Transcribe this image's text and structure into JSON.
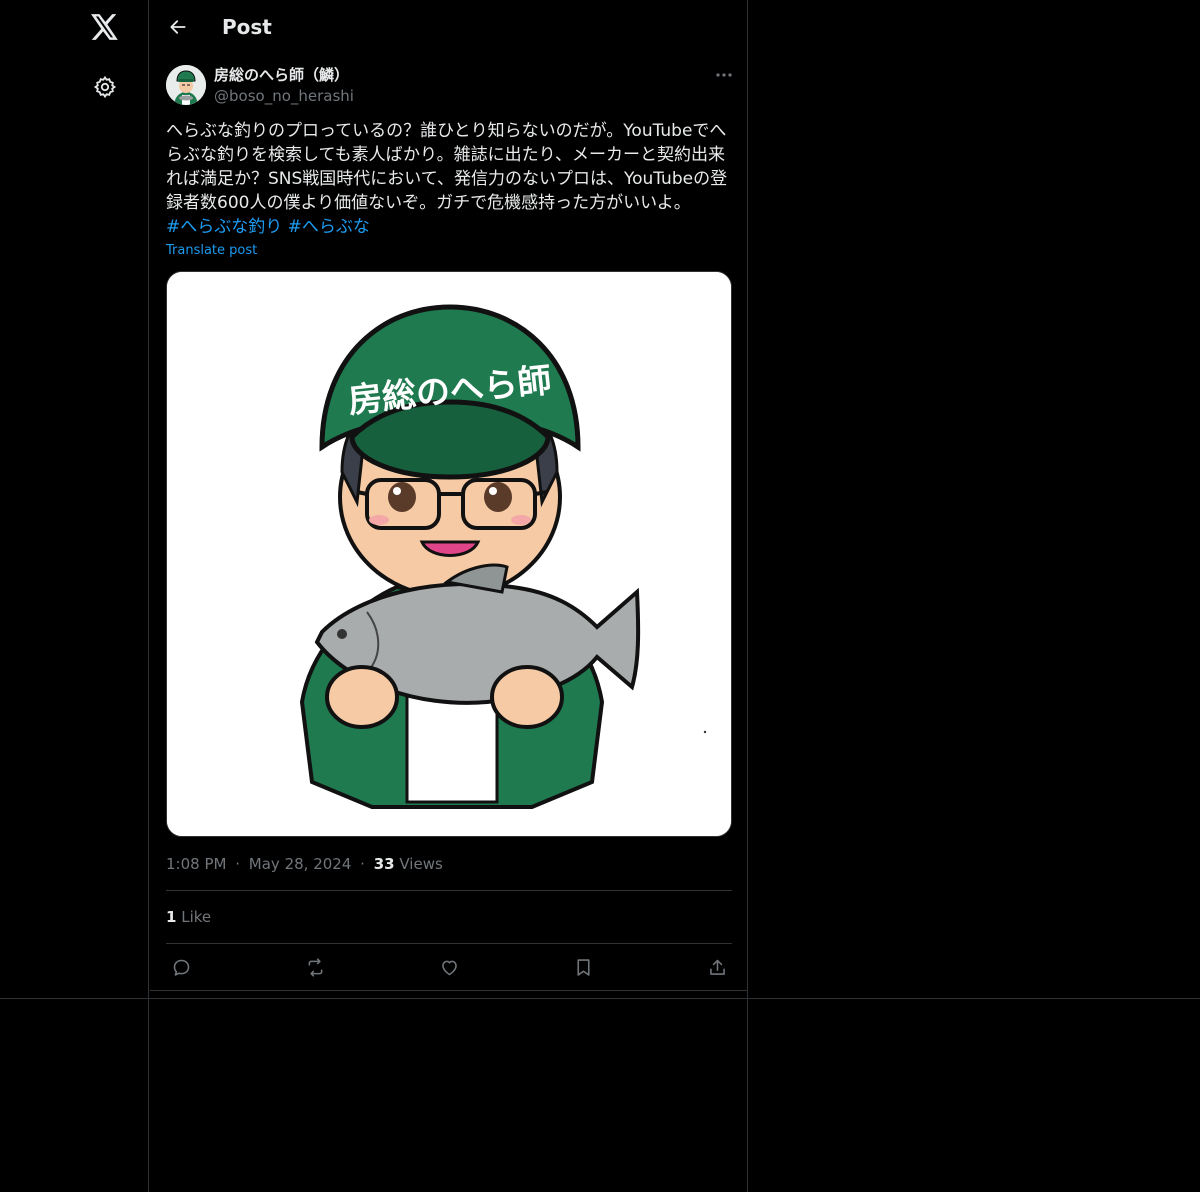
{
  "header": {
    "title": "Post",
    "back_icon": "arrow-left-icon"
  },
  "nav": {
    "logo_icon": "x-logo-icon",
    "settings_icon": "gear-icon"
  },
  "post": {
    "author": {
      "display_name": "房総のへら師（鱗）",
      "handle": "@boso_no_herashi"
    },
    "text": "へらぶな釣りのプロっているの？誰ひとり知らないのだが。YouTubeでへらぶな釣りを検索しても素人ばかり。雑誌に出たり、メーカーと契約出来れば満足か？SNS戦国時代において、発信力のないプロは、YouTubeの登録者数600人の僕より価値ないぞ。ガチで危機感持った方がいいよ。",
    "hashtags": [
      "#へらぶな釣り",
      "#へらぶな"
    ],
    "translate_label": "Translate post",
    "media": {
      "cap_text": "房総のへら師"
    },
    "time": "1:08 PM",
    "date": "May 28, 2024",
    "views_count": "33",
    "views_label": "Views",
    "likes_count": "1",
    "likes_label": "Like",
    "separator": "·"
  },
  "actions": [
    "reply-icon",
    "repost-icon",
    "like-icon",
    "bookmark-icon",
    "share-icon"
  ],
  "colors": {
    "background": "#000000",
    "text": "#e7e9ea",
    "muted": "#71767b",
    "link": "#1d9bf0",
    "border": "#2f3336",
    "cap_green": "#1f7a4f"
  }
}
